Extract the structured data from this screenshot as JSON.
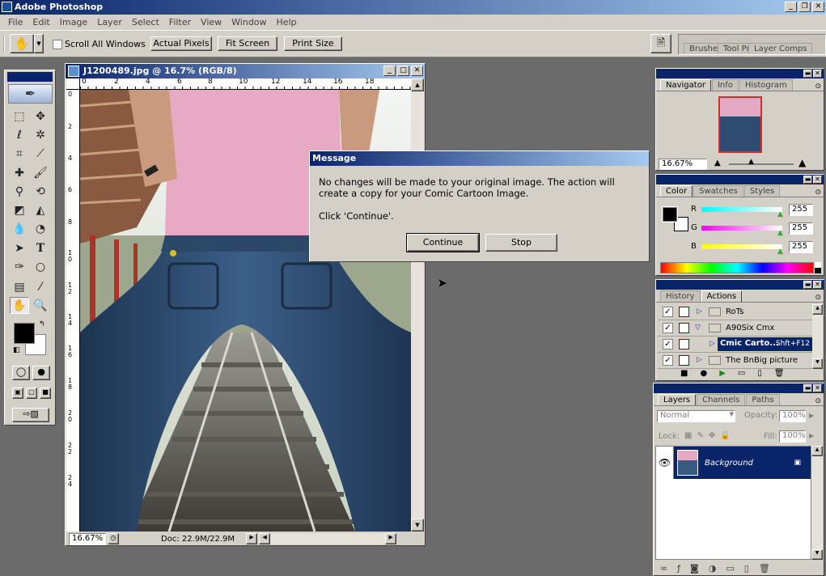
{
  "app": {
    "title": "Adobe Photoshop"
  },
  "menu": [
    "File",
    "Edit",
    "Image",
    "Layer",
    "Select",
    "Filter",
    "View",
    "Window",
    "Help"
  ],
  "options": {
    "scroll_all_windows": "Scroll All Windows",
    "actual_pixels": "Actual Pixels",
    "fit_screen": "Fit Screen",
    "print_size": "Print Size",
    "well_tabs": [
      "Brushes",
      "Tool Pr",
      "Layer Comps"
    ]
  },
  "document": {
    "title": "J1200489.jpg @ 16.7% (RGB/8)",
    "ruler_h": [
      "0",
      "2",
      "4",
      "6",
      "8",
      "10",
      "12",
      "14",
      "16",
      "18"
    ],
    "ruler_v": [
      "0",
      "2",
      "4",
      "6",
      "8",
      "1\n0",
      "1\n2",
      "1\n4",
      "1\n6",
      "1\n8",
      "2\n0",
      "2\n2",
      "2\n4"
    ],
    "zoom": "16.67%",
    "doc_size": "Doc: 22.9M/22.9M"
  },
  "dialog": {
    "title": "Message",
    "line1": "No changes will be made to your original image. The action will create a copy for your Comic Cartoon Image.",
    "line2": "Click 'Continue'.",
    "continue": "Continue",
    "stop": "Stop"
  },
  "navigator": {
    "tabs": [
      "Navigator",
      "Info",
      "Histogram"
    ],
    "zoom": "16.67%"
  },
  "color": {
    "tabs": [
      "Color",
      "Swatches",
      "Styles"
    ],
    "r_label": "R",
    "g_label": "G",
    "b_label": "B",
    "r": "255",
    "g": "255",
    "b": "255"
  },
  "actions": {
    "tabs": [
      "History",
      "Actions"
    ],
    "items": [
      {
        "label": "RoTs",
        "check": "✓"
      },
      {
        "label": "A90Six Cmx",
        "check": "✓"
      },
      {
        "label": "Cmic Carto...",
        "shortcut": "Shft+F12",
        "check": "✓"
      },
      {
        "label": "The BnBig picture",
        "check": "✓"
      }
    ]
  },
  "layers": {
    "tabs": [
      "Layers",
      "Channels",
      "Paths"
    ],
    "blend": "Normal",
    "opacity_label": "Opacity:",
    "opacity": "100%",
    "lock_label": "Lock:",
    "fill_label": "Fill:",
    "fill": "100%",
    "layer_name": "Background"
  },
  "colors": {
    "title_blue": "#0a246a",
    "face": "#d4d0c8",
    "workspace": "#6b6b6b"
  }
}
